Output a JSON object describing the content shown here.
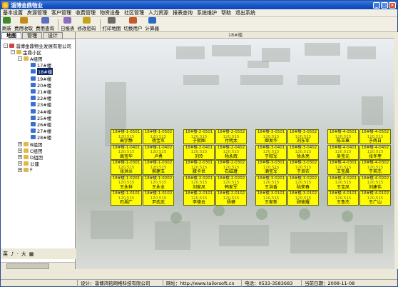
{
  "window": {
    "title": "淄博金鼎物业"
  },
  "menu": [
    "基本设置",
    "房源管理",
    "客户管理",
    "收费管理",
    "物资设备",
    "社区管理",
    "人力资源",
    "报表查询",
    "系统维护",
    "帮助",
    "退出系统"
  ],
  "toolbar": [
    {
      "label": "刷新",
      "icon": "refresh-icon",
      "color": "#3c8a2a"
    },
    {
      "label": "费用收取",
      "icon": "money-icon",
      "color": "#c48a1a"
    },
    {
      "label": "费用查询",
      "icon": "search-money-icon",
      "color": "#5a6fc4"
    },
    {
      "label": "日报表",
      "icon": "report-icon",
      "color": "#8a6ec4"
    },
    {
      "label": "修改密码",
      "icon": "password-icon",
      "color": "#c4a21a"
    },
    {
      "label": "打印地图",
      "icon": "print-icon",
      "color": "#6a6a6a"
    },
    {
      "label": "切换用户",
      "icon": "user-icon",
      "color": "#c45a2a"
    },
    {
      "label": "计算器",
      "icon": "calculator-icon",
      "color": "#2a6ac4"
    }
  ],
  "left_tabs": [
    "地图",
    "管理",
    "设计"
  ],
  "tree": [
    {
      "label": "淄博金鼎物业发展有限公司",
      "level": 0,
      "box": "-",
      "icon": "home-icon"
    },
    {
      "label": "金鼎小区",
      "level": 1,
      "box": "-",
      "icon": "folder-icon"
    },
    {
      "label": "A组团",
      "level": 2,
      "box": "-",
      "icon": "folder-icon"
    },
    {
      "label": "17#楼",
      "level": 3,
      "icon": "building-icon"
    },
    {
      "label": "18#楼",
      "level": 3,
      "icon": "building-icon",
      "selected": true
    },
    {
      "label": "19#楼",
      "level": 3,
      "icon": "building-icon"
    },
    {
      "label": "20#楼",
      "level": 3,
      "icon": "building-icon"
    },
    {
      "label": "21#楼",
      "level": 3,
      "icon": "building-icon"
    },
    {
      "label": "22#楼",
      "level": 3,
      "icon": "building-icon"
    },
    {
      "label": "23#楼",
      "level": 3,
      "icon": "building-icon"
    },
    {
      "label": "24#楼",
      "level": 3,
      "icon": "building-icon"
    },
    {
      "label": "25#楼",
      "level": 3,
      "icon": "building-icon"
    },
    {
      "label": "26#楼",
      "level": 3,
      "icon": "building-icon"
    },
    {
      "label": "27#楼",
      "level": 3,
      "icon": "building-icon"
    },
    {
      "label": "28#楼",
      "level": 3,
      "icon": "building-icon"
    },
    {
      "label": "B组团",
      "level": 2,
      "box": "+",
      "icon": "folder-icon"
    },
    {
      "label": "C组团",
      "level": 2,
      "box": "+",
      "icon": "folder-icon"
    },
    {
      "label": "D组团",
      "level": 2,
      "box": "+",
      "icon": "folder-icon"
    },
    {
      "label": "公建",
      "level": 2,
      "box": "+",
      "icon": "folder-icon"
    },
    {
      "label": "F",
      "level": 2,
      "box": "+",
      "icon": "folder-icon"
    }
  ],
  "ime": [
    "英",
    "♪",
    "·",
    "大",
    "▦"
  ],
  "main_header": "18#楼",
  "units": [
    {
      "rooms": [
        [
          "18#楼-1-0501",
          "120.515",
          "高宇静"
        ],
        [
          "18#楼-1-0502",
          "120.515",
          "杨宝军"
        ],
        [
          "18#楼-1-0401",
          "120.515",
          "高宝华"
        ],
        [
          "18#楼-1-0402",
          "120.515",
          "卢勇"
        ],
        [
          "18#楼-1-0301",
          "120.515",
          "张洪兰"
        ],
        [
          "18#楼-1-0302",
          "120.515",
          "郝建玉"
        ],
        [
          "18#楼-1-0201",
          "120.515",
          "王永祥"
        ],
        [
          "18#楼-1-0202",
          "120.515",
          "王永全"
        ],
        [
          "18#楼-1-0101",
          "120.515",
          "石湘广"
        ],
        [
          "18#楼-1-0102",
          "120.515",
          "尹武武"
        ]
      ]
    },
    {
      "rooms": [
        [
          "18#楼-2-0501",
          "120.515",
          "于熙图"
        ],
        [
          "18#楼-2-0502",
          "120.515",
          "付明太"
        ],
        [
          "18#楼-2-0401",
          "120.515",
          "刘玲"
        ],
        [
          "18#楼-2-0402",
          "120.515",
          "杨永辉"
        ],
        [
          "18#楼-2-0301",
          "120.515",
          "滕卡世"
        ],
        [
          "18#楼-2-0302",
          "120.515",
          "石磁瓘"
        ],
        [
          "18#楼-2-0201",
          "120.515",
          "刘家凤"
        ],
        [
          "18#楼-2-0202",
          "120.515",
          "韩家军"
        ],
        [
          "18#楼-2-0101",
          "120.515",
          "李德云"
        ],
        [
          "18#楼-2-0102",
          "120.515",
          "杨健"
        ]
      ]
    },
    {
      "rooms": [
        [
          "18#楼-3-0501",
          "120.515",
          "卿发华"
        ],
        [
          "18#楼-3-0502",
          "120.515",
          "刘东军"
        ],
        [
          "18#楼-3-0401",
          "120.515",
          "于阳军"
        ],
        [
          "18#楼-3-0402",
          "120.515",
          "徐永亮"
        ],
        [
          "18#楼-3-0301",
          "120.515",
          "酒宝军"
        ],
        [
          "18#楼-3-0302",
          "120.515",
          "于良农"
        ],
        [
          "18#楼-3-0201",
          "120.515",
          "王洪香"
        ],
        [
          "18#楼-3-0202",
          "120.515",
          "陆荣春"
        ],
        [
          "18#楼-3-0101",
          "120.515",
          "王家新"
        ],
        [
          "18#楼-3-0102",
          "120.515",
          "顾彼耀"
        ]
      ]
    },
    {
      "rooms": [
        [
          "18#楼-4-0501",
          "120.515",
          "陈玉章"
        ],
        [
          "18#楼-4-0502",
          "120.515",
          "于辉日"
        ],
        [
          "18#楼-4-0401",
          "120.515",
          "吴宝元"
        ],
        [
          "18#楼-4-0402",
          "120.515",
          "张冬奎"
        ],
        [
          "18#楼-4-0301",
          "120.515",
          "王宝晨"
        ],
        [
          "18#楼-4-0302",
          "120.515",
          "于英杰"
        ],
        [
          "18#楼-4-0201",
          "120.515",
          "王宝凤"
        ],
        [
          "18#楼-4-0202",
          "120.515",
          "刘建伟"
        ],
        [
          "18#楼-4-0101",
          "120.515",
          "王鲁杰"
        ],
        [
          "18#楼-4-0102",
          "120.515",
          "王广山"
        ]
      ]
    }
  ],
  "status": {
    "designer": "设计：淄博鸿铭网络科技有限公司",
    "website": "网址：http://www.tailorsoft.cn",
    "phone": "电话：0533-3583683",
    "date_label": "当前日期：",
    "date": "2008-11-08"
  }
}
